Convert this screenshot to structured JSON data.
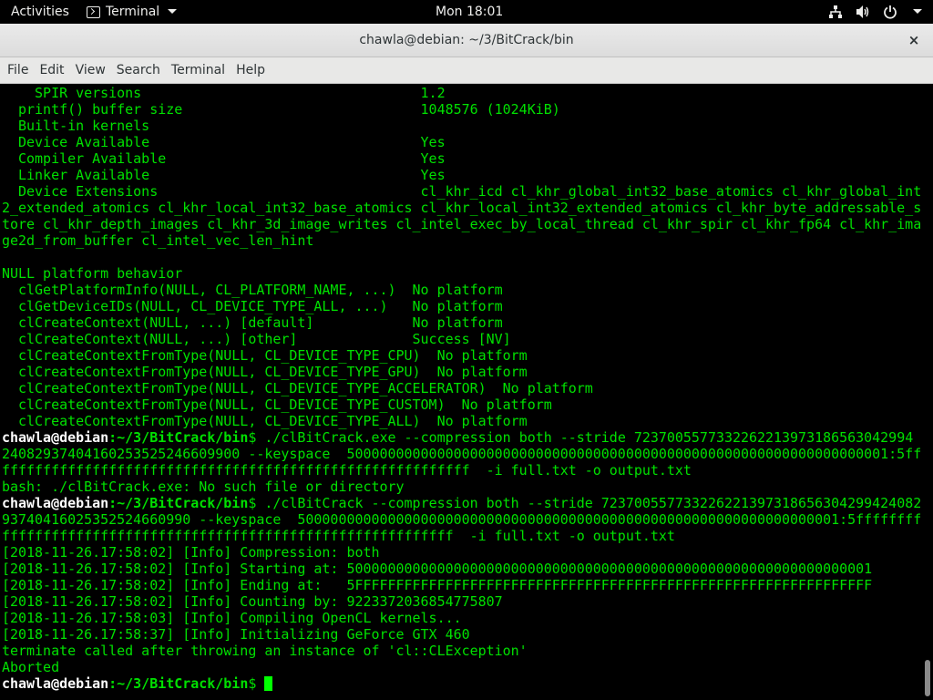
{
  "topbar": {
    "activities": "Activities",
    "app_name": "Terminal",
    "clock": "Mon 18:01",
    "icons": [
      "network-icon",
      "volume-icon",
      "power-icon"
    ]
  },
  "window": {
    "title": "chawla@debian: ~/3/BitCrack/bin",
    "close_glyph": "×"
  },
  "menubar": {
    "items": [
      "File",
      "Edit",
      "View",
      "Search",
      "Terminal",
      "Help"
    ]
  },
  "prompt": {
    "user": "chawla@debian",
    "path": ":~/3/BitCrack/bin",
    "sep": "$ "
  },
  "terminal": {
    "lines": [
      "    SPIR versions                                  1.2",
      "  printf() buffer size                             1048576 (1024KiB)",
      "  Built-in kernels",
      "  Device Available                                 Yes",
      "  Compiler Available                               Yes",
      "  Linker Available                                 Yes",
      "  Device Extensions                                cl_khr_icd cl_khr_global_int32_base_atomics cl_khr_global_int3",
      "2_extended_atomics cl_khr_local_int32_base_atomics cl_khr_local_int32_extended_atomics cl_khr_byte_addressable_s",
      "tore cl_khr_depth_images cl_khr_3d_image_writes cl_intel_exec_by_local_thread cl_khr_spir cl_khr_fp64 cl_khr_ima",
      "ge2d_from_buffer cl_intel_vec_len_hint",
      "",
      "NULL platform behavior",
      "  clGetPlatformInfo(NULL, CL_PLATFORM_NAME, ...)  No platform",
      "  clGetDeviceIDs(NULL, CL_DEVICE_TYPE_ALL, ...)   No platform",
      "  clCreateContext(NULL, ...) [default]            No platform",
      "  clCreateContext(NULL, ...) [other]              Success [NV]",
      "  clCreateContextFromType(NULL, CL_DEVICE_TYPE_CPU)  No platform",
      "  clCreateContextFromType(NULL, CL_DEVICE_TYPE_GPU)  No platform",
      "  clCreateContextFromType(NULL, CL_DEVICE_TYPE_ACCELERATOR)  No platform",
      "  clCreateContextFromType(NULL, CL_DEVICE_TYPE_CUSTOM)  No platform",
      "  clCreateContextFromType(NULL, CL_DEVICE_TYPE_ALL)  No platform"
    ],
    "cmd1": [
      "./clBitCrack.exe --compression both --stride 7237005577332262213973186563042994",
      "24082937404160253525246609900 --keyspace  500000000000000000000000000000000000000000000000000000000000000001:5ffffff",
      "fffffffffffffffffffffffffffffffffffffffffffffffffffffffff  -i full.txt -o output.txt"
    ],
    "cmd1_error": "bash: ./clBitCrack.exe: No such file or directory",
    "cmd2": [
      "./clBitCrack --compression both --stride 723700557733226221397318656304299424082",
      "93740416025352524660990 --keyspace  500000000000000000000000000000000000000000000000000000000000000001:5ffffffffff",
      "fffffffffffffffffffffffffffffffffffffffffffffffffffffff  -i full.txt -o output.txt"
    ],
    "log": [
      "[2018-11-26.17:58:02] [Info] Compression: both",
      "[2018-11-26.17:58:02] [Info] Starting at: 5000000000000000000000000000000000000000000000000000000000000001",
      "[2018-11-26.17:58:02] [Info] Ending at:   5FFFFFFFFFFFFFFFFFFFFFFFFFFFFFFFFFFFFFFFFFFFFFFFFFFFFFFFFFFFFFFF",
      "[2018-11-26.17:58:02] [Info] Counting by: 9223372036854775807",
      "[2018-11-26.17:58:03] [Info] Compiling OpenCL kernels...",
      "[2018-11-26.17:58:37] [Info] Initializing GeForce GTX 460",
      "terminate called after throwing an instance of 'cl::CLException'",
      "Aborted"
    ]
  },
  "colors": {
    "terminal_fg": "#00e000",
    "terminal_bg": "#000000",
    "prompt_user": "#ffffff"
  }
}
